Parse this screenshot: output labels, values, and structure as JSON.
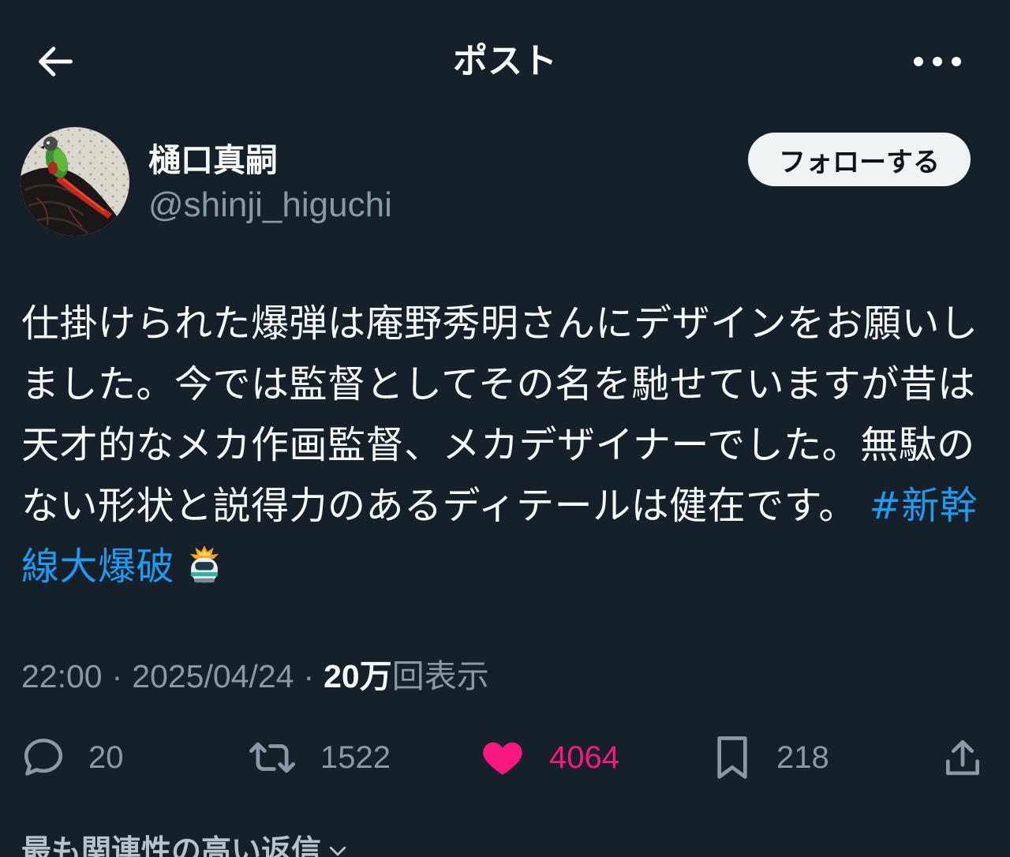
{
  "header": {
    "title": "ポスト",
    "back_icon": "arrow-left-icon",
    "more_icon": "more-horizontal-icon"
  },
  "author": {
    "name": "樋口真嗣",
    "handle": "@shinji_higuchi",
    "follow_label": "フォローする",
    "avatar_icon": "avatar-parrot-photo"
  },
  "post": {
    "text": "仕掛けられた爆弾は庵野秀明さんにデザインをお願いしました。今では監督としてその名を馳せていますが昔は天才的なメカ作画監督、メカデザイナーでした。無駄のない形状と説得力のあるディテールは健在です。 ",
    "hashtag": "#新幹線大爆破",
    "hashtag_emoji_icon": "shinkansen-explosion-emoji"
  },
  "meta": {
    "time": "22:00",
    "separator": "·",
    "date": "2025/04/24",
    "views_count": "20万",
    "views_label": "回表示"
  },
  "actions": {
    "reply": {
      "icon": "reply-icon",
      "count": "20"
    },
    "repost": {
      "icon": "repost-icon",
      "count": "1522"
    },
    "like": {
      "icon": "heart-filled-icon",
      "count": "4064"
    },
    "bookmark": {
      "icon": "bookmark-icon",
      "count": "218"
    },
    "share": {
      "icon": "share-icon"
    }
  },
  "replies_sort": {
    "label": "最も関連性の高い返信",
    "icon": "chevron-down-icon"
  },
  "colors": {
    "background": "#15202b",
    "text": "#f7f9f9",
    "secondary_text": "#8b98a5",
    "link": "#1d9bf0",
    "like": "#f91880",
    "follow_button_bg": "#eff3f4",
    "follow_button_text": "#0f1419"
  }
}
